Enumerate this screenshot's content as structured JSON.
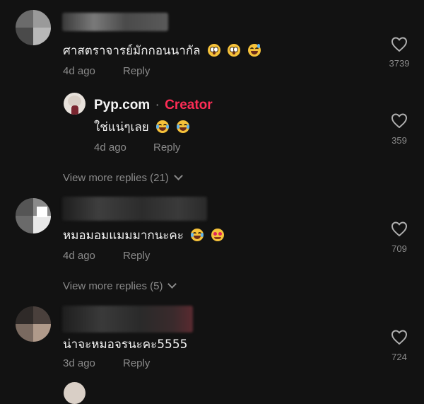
{
  "comments": [
    {
      "text": "ศาสตราจารย์มักกอนนากัล",
      "emojis": [
        "flushed-face-emoji",
        "flushed-face-emoji",
        "grinning-sweat-emoji"
      ],
      "time": "4d ago",
      "reply_label": "Reply",
      "likes": "3739"
    },
    {
      "author": "Pyp.com",
      "separator": "·",
      "badge": "Creator",
      "text": "ใช่แน่ๆเลย",
      "emojis": [
        "tears-of-joy-emoji",
        "tears-of-joy-emoji"
      ],
      "time": "4d ago",
      "reply_label": "Reply",
      "likes": "359"
    },
    {
      "text": "หมอมอมแมมมากนะคะ",
      "emojis": [
        "tears-of-joy-emoji",
        "smiling-hearts-emoji"
      ],
      "time": "4d ago",
      "reply_label": "Reply",
      "likes": "709"
    },
    {
      "text": "น่าจะหมอจรนะคะ5555",
      "emojis": [],
      "time": "3d ago",
      "reply_label": "Reply",
      "likes": "724"
    }
  ],
  "view_more": [
    "View more replies (21)",
    "View more replies (5)"
  ],
  "icons": {
    "like": "heart-outline-icon",
    "expand": "chevron-down-icon"
  },
  "colors": {
    "background": "#121212",
    "creator_badge": "#fe2c55",
    "muted_text": "#8a8a8a"
  }
}
